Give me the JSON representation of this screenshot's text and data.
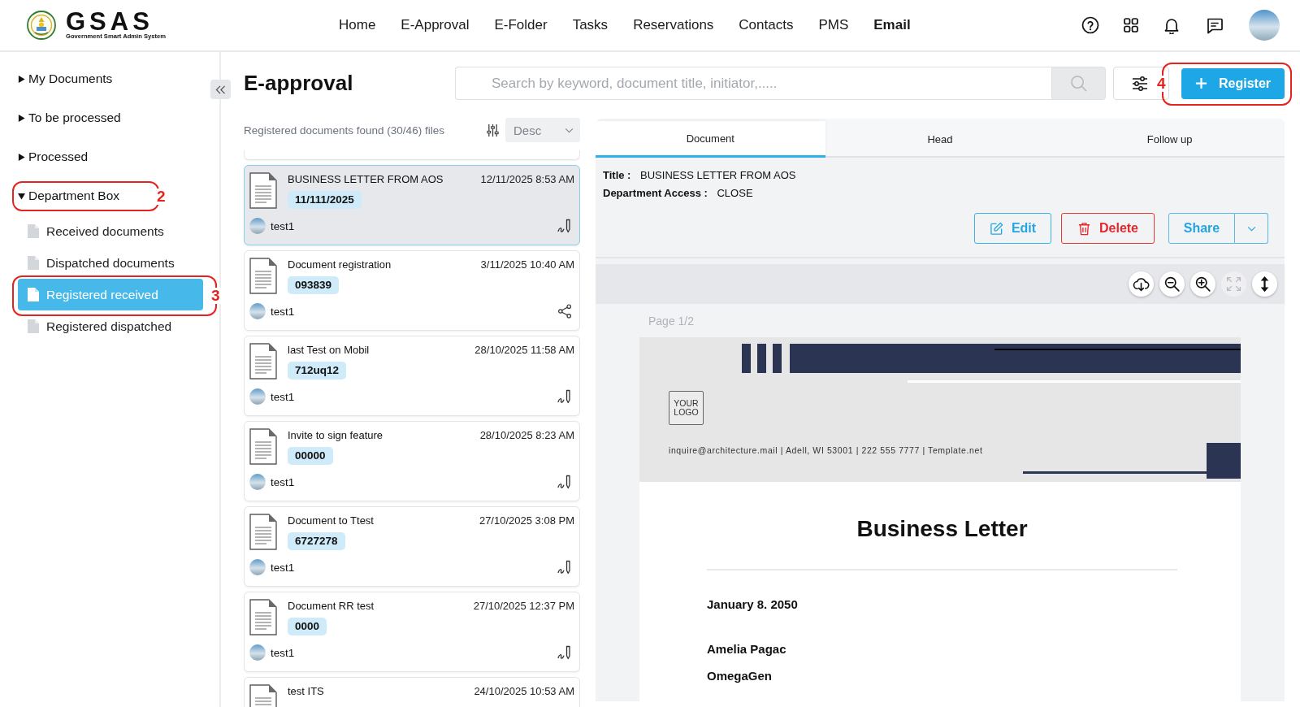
{
  "header": {
    "logo": {
      "title": "GSAS",
      "subtitle": "Government Smart Admin System"
    },
    "nav": [
      {
        "label": "Home",
        "selected": false
      },
      {
        "label": "E-Approval",
        "selected": false
      },
      {
        "label": "E-Folder",
        "selected": false
      },
      {
        "label": "Tasks",
        "selected": false
      },
      {
        "label": "Reservations",
        "selected": false
      },
      {
        "label": "Contacts",
        "selected": false
      },
      {
        "label": "PMS",
        "selected": false
      },
      {
        "label": "Email",
        "selected": true
      }
    ]
  },
  "sidebar": {
    "items": [
      {
        "label": "My Documents",
        "expanded": false
      },
      {
        "label": "To be processed",
        "expanded": false
      },
      {
        "label": "Processed",
        "expanded": false
      },
      {
        "label": "Department Box",
        "expanded": true,
        "annotation": "2",
        "children": [
          {
            "label": "Received documents",
            "selected": false
          },
          {
            "label": "Dispatched documents",
            "selected": false
          },
          {
            "label": "Registered received",
            "selected": true,
            "annotation": "3"
          },
          {
            "label": "Registered dispatched",
            "selected": false
          }
        ]
      }
    ]
  },
  "page": {
    "title": "E-approval",
    "search": {
      "placeholder": "Search by keyword, document title, initiator,....."
    },
    "register_button": {
      "label": "Register",
      "annotation": "4"
    }
  },
  "list": {
    "summary": "Registered documents found (30/46) files",
    "sort": {
      "value": "Desc"
    },
    "items": [
      {
        "title": "BUSINESS LETTER FROM AOS",
        "date": "12/11/2025 8:53 AM",
        "tag": "11/111/2025",
        "user": "test1",
        "kind": "sign",
        "selected": true
      },
      {
        "title": "Document registration",
        "date": "3/11/2025 10:40 AM",
        "tag": "093839",
        "user": "test1",
        "kind": "share",
        "selected": false
      },
      {
        "title": "last Test on Mobil",
        "date": "28/10/2025 11:58 AM",
        "tag": "712uq12",
        "user": "test1",
        "kind": "sign",
        "selected": false
      },
      {
        "title": "Invite to sign feature",
        "date": "28/10/2025 8:23 AM",
        "tag": "00000",
        "user": "test1",
        "kind": "sign",
        "selected": false
      },
      {
        "title": "Document to Ttest",
        "date": "27/10/2025 3:08 PM",
        "tag": "6727278",
        "user": "test1",
        "kind": "sign",
        "selected": false
      },
      {
        "title": "Document RR test",
        "date": "27/10/2025 12:37 PM",
        "tag": "0000",
        "user": "test1",
        "kind": "sign",
        "selected": false
      },
      {
        "title": "test ITS",
        "date": "24/10/2025 10:53 AM",
        "selected": false
      }
    ]
  },
  "detail": {
    "tabs": [
      {
        "label": "Document",
        "selected": true
      },
      {
        "label": "Head",
        "selected": false
      },
      {
        "label": "Follow up",
        "selected": false
      }
    ],
    "fields": [
      {
        "label": "Title :",
        "value": "BUSINESS LETTER FROM AOS"
      },
      {
        "label": "Department Access :",
        "value": "CLOSE"
      }
    ],
    "actions": [
      {
        "kind": "edit",
        "label": "Edit"
      },
      {
        "kind": "delete",
        "label": "Delete"
      },
      {
        "kind": "share",
        "label": "Share"
      }
    ],
    "viewer": {
      "tools": [
        {
          "kind": "download",
          "disabled": false
        },
        {
          "kind": "zoom_out",
          "disabled": false
        },
        {
          "kind": "zoom_in",
          "disabled": false
        },
        {
          "kind": "fit",
          "disabled": true
        },
        {
          "kind": "fit_height",
          "disabled": false
        }
      ],
      "page_label": "Page 1/2",
      "document": {
        "logo": "YOUR LOGO",
        "contact": "inquire@architecture.mail | Adell, WI 53001 | 222 555 7777 | Template.net",
        "heading": "Business Letter",
        "date": "January 8. 2050",
        "lines": [
          "Amelia Pagac",
          "OmegaGen"
        ]
      }
    }
  }
}
